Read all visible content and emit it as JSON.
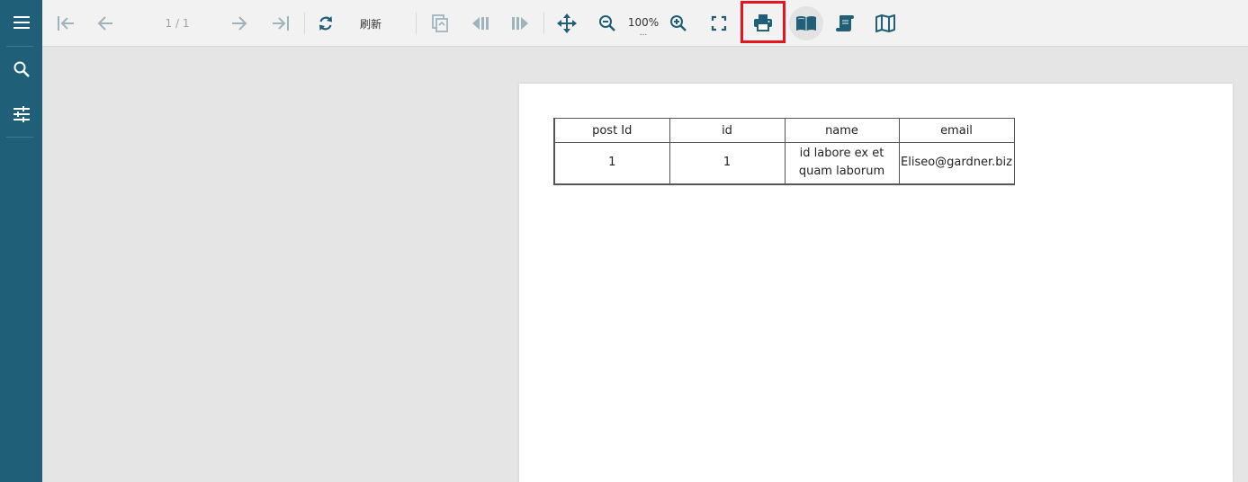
{
  "toolbar": {
    "page_indicator": "1 / 1",
    "refresh_label": "刷新",
    "zoom_level": "100%",
    "zoom_more": "...",
    "icons": [
      "first-page-icon",
      "prev-page-icon",
      "next-page-icon",
      "last-page-icon",
      "refresh-icon",
      "export-icon",
      "prev-section-icon",
      "next-section-icon",
      "move-icon",
      "zoom-out-icon",
      "zoom-in-icon",
      "fullscreen-icon",
      "print-icon",
      "book-open-icon",
      "scroll-icon",
      "map-icon"
    ],
    "colors": {
      "accent": "#205f78",
      "disabled": "#9fb3bd",
      "highlight": "#e6141e"
    }
  },
  "sidebar": {
    "icons": [
      "menu-icon",
      "search-icon",
      "parameters-icon"
    ]
  },
  "report": {
    "columns": [
      "post Id",
      "id",
      "name",
      "email"
    ],
    "rows": [
      {
        "post_id": "1",
        "id": "1",
        "name_line1": "id labore ex et",
        "name_line2": "quam laborum",
        "email": "Eliseo@gardner.biz"
      }
    ]
  }
}
